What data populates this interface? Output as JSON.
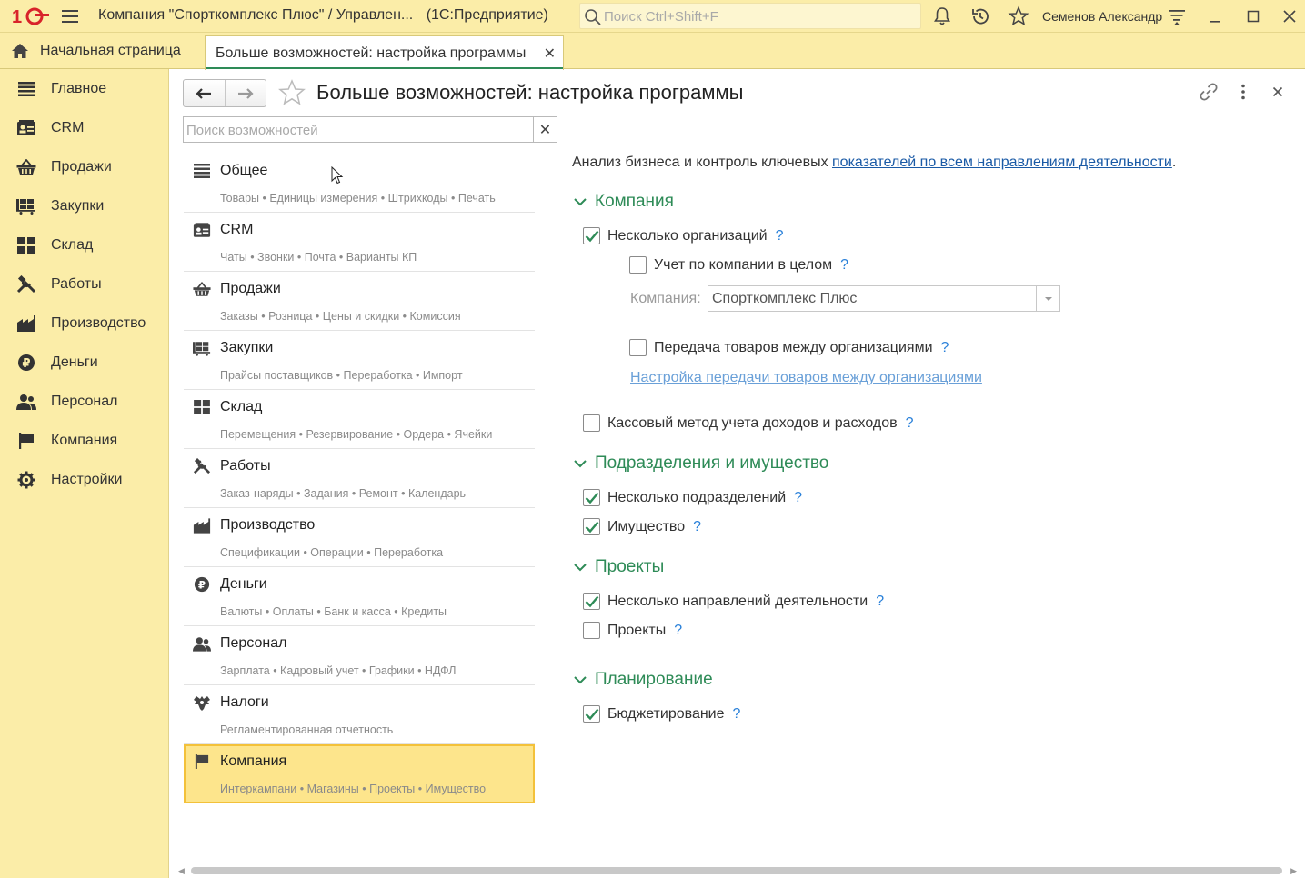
{
  "titlebar": {
    "app_title": "Компания \"Спорткомплекс Плюс\" / Управлен...",
    "platform": "(1С:Предприятие)",
    "search_placeholder": "Поиск Ctrl+Shift+F",
    "user": "Семенов Александр"
  },
  "tabs": {
    "home": "Начальная страница",
    "active": "Больше возможностей: настройка программы"
  },
  "sidebar": {
    "items": [
      {
        "label": "Главное",
        "icon": "list-icon"
      },
      {
        "label": "CRM",
        "icon": "contact-card-icon"
      },
      {
        "label": "Продажи",
        "icon": "basket-icon"
      },
      {
        "label": "Закупки",
        "icon": "cart-icon"
      },
      {
        "label": "Склад",
        "icon": "warehouse-icon"
      },
      {
        "label": "Работы",
        "icon": "tools-icon"
      },
      {
        "label": "Производство",
        "icon": "factory-icon"
      },
      {
        "label": "Деньги",
        "icon": "ruble-icon"
      },
      {
        "label": "Персонал",
        "icon": "people-icon"
      },
      {
        "label": "Компания",
        "icon": "flag-icon"
      },
      {
        "label": "Настройки",
        "icon": "gear-icon"
      }
    ]
  },
  "page": {
    "title": "Больше возможностей: настройка программы",
    "feature_search_placeholder": "Поиск возможностей"
  },
  "sections": [
    {
      "name": "Общее",
      "sub": "Товары • Единицы измерения • Штрихкоды • Печать",
      "icon": "list-icon"
    },
    {
      "name": "CRM",
      "sub": "Чаты • Звонки • Почта • Варианты КП",
      "icon": "contact-card-icon"
    },
    {
      "name": "Продажи",
      "sub": "Заказы • Розница • Цены и скидки • Комиссия",
      "icon": "basket-icon"
    },
    {
      "name": "Закупки",
      "sub": "Прайсы поставщиков • Переработка • Импорт",
      "icon": "cart-icon"
    },
    {
      "name": "Склад",
      "sub": "Перемещения • Резервирование • Ордера • Ячейки",
      "icon": "warehouse-icon"
    },
    {
      "name": "Работы",
      "sub": "Заказ-наряды • Задания • Ремонт • Календарь",
      "icon": "tools-icon"
    },
    {
      "name": "Производство",
      "sub": "Спецификации • Операции • Переработка",
      "icon": "factory-icon"
    },
    {
      "name": "Деньги",
      "sub": "Валюты • Оплаты • Банк и касса • Кредиты",
      "icon": "ruble-icon"
    },
    {
      "name": "Персонал",
      "sub": "Зарплата • Кадровый учет • Графики • НДФЛ",
      "icon": "people-icon"
    },
    {
      "name": "Налоги",
      "sub": "Регламентированная отчетность",
      "icon": "eagle-icon"
    },
    {
      "name": "Компания",
      "sub": "Интеркампани • Магазины • Проекты • Имущество",
      "icon": "flag-icon"
    }
  ],
  "detail": {
    "intro_text": "Анализ бизнеса и контроль ключевых ",
    "intro_link": "показателей по всем направлениям деятельности",
    "intro_end": ".",
    "groups": {
      "company": "Компания",
      "divisions": "Подразделения и имущество",
      "projects": "Проекты",
      "planning": "Планирование"
    },
    "options": {
      "multi_org": {
        "label": "Несколько организаций",
        "checked": true
      },
      "company_whole": {
        "label": "Учет по компании в целом",
        "checked": false
      },
      "transfer": {
        "label": "Передача товаров между организациями",
        "checked": false
      },
      "cash_method": {
        "label": "Кассовый метод учета доходов и расходов",
        "checked": false
      },
      "multi_div": {
        "label": "Несколько подразделений",
        "checked": true
      },
      "property": {
        "label": "Имущество",
        "checked": true
      },
      "multi_dir": {
        "label": "Несколько направлений деятельности",
        "checked": true
      },
      "projects": {
        "label": "Проекты",
        "checked": false
      },
      "budgeting": {
        "label": "Бюджетирование",
        "checked": true
      }
    },
    "help_mark": "?",
    "company_label": "Компания:",
    "company_value": "Спорткомплекс Плюс",
    "transfer_link": "Настройка передачи товаров между организациями"
  },
  "colors": {
    "panel_yellow": "#fbeda8",
    "active_section": "#fde58c",
    "active_border": "#f3c13a",
    "group_green": "#2e8b57",
    "link_blue": "#1a5aa6"
  }
}
